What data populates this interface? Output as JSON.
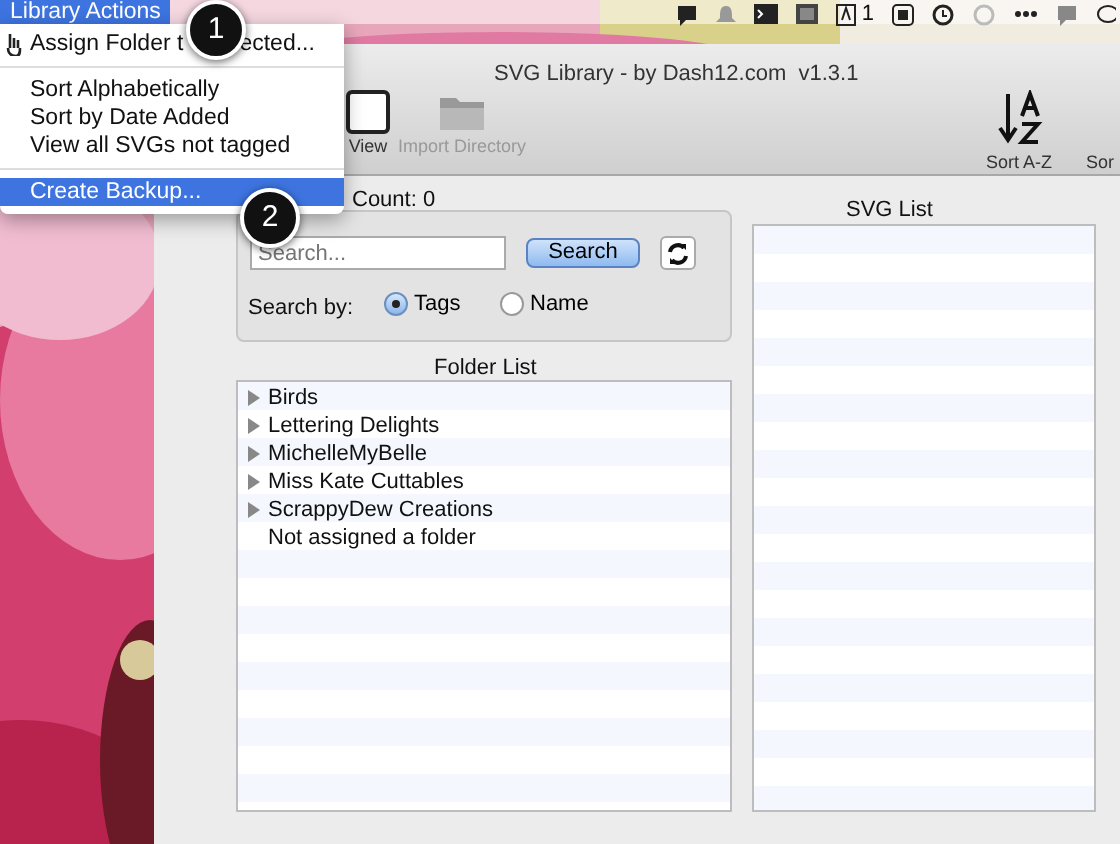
{
  "menu_bar": {
    "menus": [
      {
        "label": "Library Actions",
        "selected": true
      }
    ],
    "status_count": "1"
  },
  "dropdown": {
    "items": [
      {
        "kind": "item",
        "label_parts": [
          "Assign Folder t",
          "ected..."
        ],
        "selected": false,
        "icon": true
      },
      {
        "kind": "separator"
      },
      {
        "kind": "item",
        "label_parts": [
          "Sort Alphabetically"
        ],
        "selected": false
      },
      {
        "kind": "item",
        "label_parts": [
          "Sort by Date Added"
        ],
        "selected": false
      },
      {
        "kind": "item",
        "label_parts": [
          "View all SVGs not tagged"
        ],
        "selected": false
      },
      {
        "kind": "separator"
      },
      {
        "kind": "item",
        "label_parts": [
          "Create Backup..."
        ],
        "selected": true
      }
    ]
  },
  "callouts": [
    "1",
    "2"
  ],
  "window": {
    "title": "SVG Library - by Dash12.com  v1.3.1"
  },
  "toolbar": [
    {
      "kind": "view",
      "label": "View",
      "disabled": false
    },
    {
      "kind": "folder",
      "label": "Import Directory",
      "disabled": true
    },
    {
      "kind": "sort",
      "label": "Sort A-Z",
      "disabled": false
    },
    {
      "kind": "cut",
      "label": "Sor",
      "disabled": false
    }
  ],
  "count": "Count: 0",
  "search": {
    "placeholder": "Search...",
    "button": "Search",
    "label": "Search by:",
    "options": [
      {
        "label": "Tags",
        "selected": true
      },
      {
        "label": "Name",
        "selected": false
      }
    ]
  },
  "folder_list": {
    "title": "Folder List",
    "items": [
      {
        "label": "Birds",
        "kind": "group",
        "expanded": false
      },
      {
        "label": "Lettering Delights",
        "kind": "group",
        "expanded": false
      },
      {
        "label": "MichelleMyBelle",
        "kind": "group",
        "expanded": false
      },
      {
        "label": "Miss Kate Cuttables",
        "kind": "group",
        "expanded": false
      },
      {
        "label": "ScrappyDew Creations",
        "kind": "group",
        "expanded": false
      },
      {
        "label": "Not assigned a folder",
        "kind": "plain"
      }
    ]
  },
  "svg_list": {
    "title": "SVG List"
  }
}
